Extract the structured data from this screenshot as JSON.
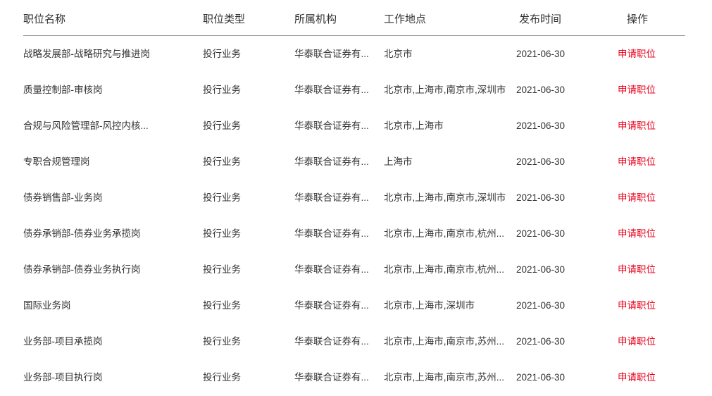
{
  "table": {
    "columns": [
      {
        "key": "title",
        "label": "职位名称"
      },
      {
        "key": "type",
        "label": "职位类型"
      },
      {
        "key": "org",
        "label": "所属机构"
      },
      {
        "key": "loc",
        "label": "工作地点"
      },
      {
        "key": "date",
        "label": "发布时间"
      },
      {
        "key": "action",
        "label": "操作"
      }
    ],
    "action_label": "申请职位",
    "action_color": "#e8001c",
    "rows": [
      {
        "title": "战略发展部-战略研究与推进岗",
        "type": "投行业务",
        "org": "华泰联合证券有...",
        "loc": "北京市",
        "date": "2021-06-30",
        "action": "申请职位"
      },
      {
        "title": "质量控制部-审核岗",
        "type": "投行业务",
        "org": "华泰联合证券有...",
        "loc": "北京市,上海市,南京市,深圳市",
        "date": "2021-06-30",
        "action": "申请职位"
      },
      {
        "title": "合规与风险管理部-风控内核...",
        "type": "投行业务",
        "org": "华泰联合证券有...",
        "loc": "北京市,上海市",
        "date": "2021-06-30",
        "action": "申请职位"
      },
      {
        "title": "专职合规管理岗",
        "type": "投行业务",
        "org": "华泰联合证券有...",
        "loc": "上海市",
        "date": "2021-06-30",
        "action": "申请职位"
      },
      {
        "title": "债券销售部-业务岗",
        "type": "投行业务",
        "org": "华泰联合证券有...",
        "loc": "北京市,上海市,南京市,深圳市",
        "date": "2021-06-30",
        "action": "申请职位"
      },
      {
        "title": "债券承销部-债券业务承揽岗",
        "type": "投行业务",
        "org": "华泰联合证券有...",
        "loc": "北京市,上海市,南京市,杭州...",
        "date": "2021-06-30",
        "action": "申请职位"
      },
      {
        "title": "债券承销部-债券业务执行岗",
        "type": "投行业务",
        "org": "华泰联合证券有...",
        "loc": "北京市,上海市,南京市,杭州...",
        "date": "2021-06-30",
        "action": "申请职位"
      },
      {
        "title": "国际业务岗",
        "type": "投行业务",
        "org": "华泰联合证券有...",
        "loc": "北京市,上海市,深圳市",
        "date": "2021-06-30",
        "action": "申请职位"
      },
      {
        "title": "业务部-项目承揽岗",
        "type": "投行业务",
        "org": "华泰联合证券有...",
        "loc": "北京市,上海市,南京市,苏州...",
        "date": "2021-06-30",
        "action": "申请职位"
      },
      {
        "title": "业务部-项目执行岗",
        "type": "投行业务",
        "org": "华泰联合证券有...",
        "loc": "北京市,上海市,南京市,苏州...",
        "date": "2021-06-30",
        "action": "申请职位"
      }
    ]
  }
}
